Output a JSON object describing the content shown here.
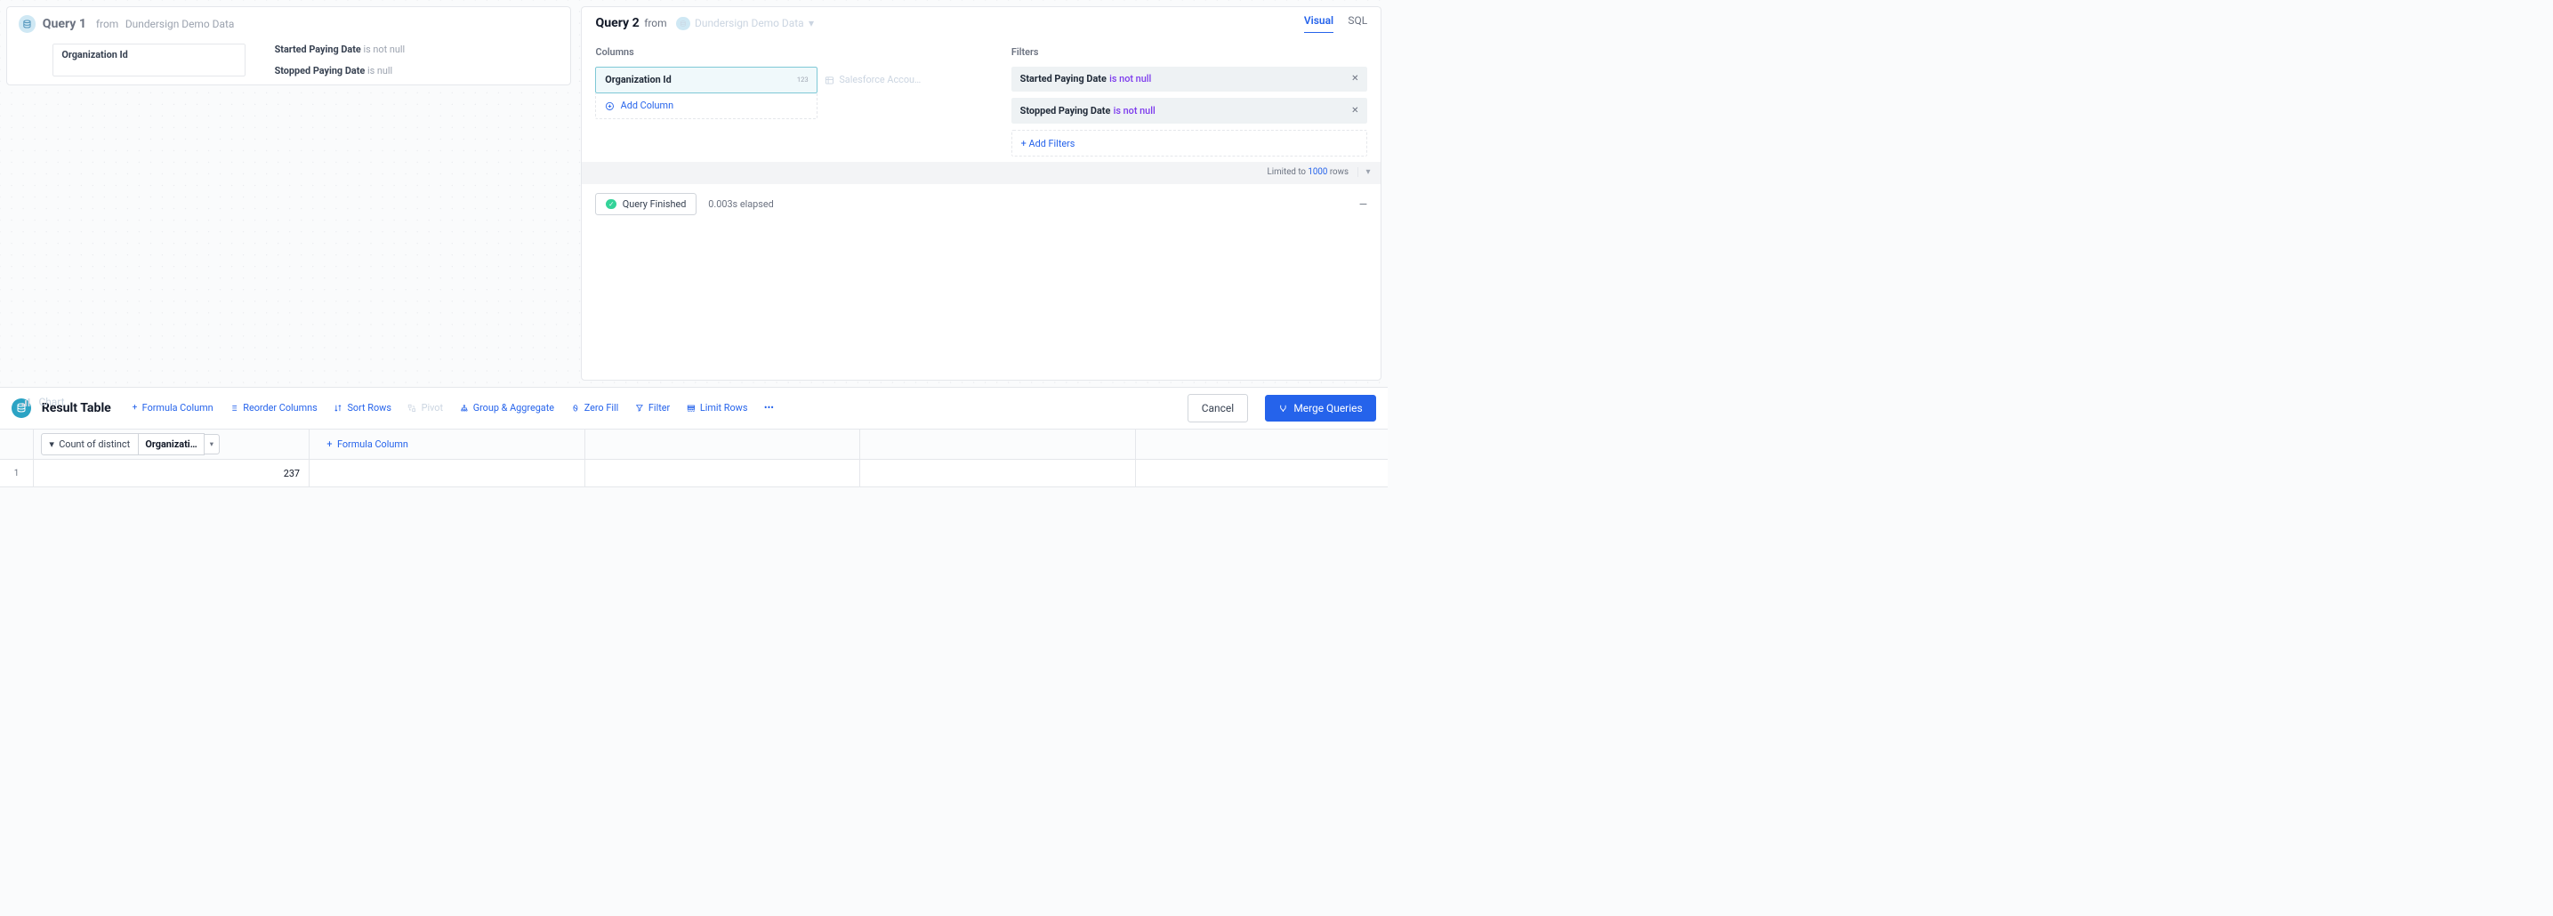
{
  "query1": {
    "title": "Query 1",
    "from_label": "from",
    "source": "Dundersign Demo Data",
    "column_chip": "Organization Id",
    "filters": [
      {
        "field": "Started Paying Date",
        "condition": "is not null"
      },
      {
        "field": "Stopped Paying Date",
        "condition": "is null"
      }
    ],
    "chart_label": "Chart"
  },
  "query2": {
    "title": "Query 2",
    "from_label": "from",
    "source": "Dundersign Demo Data",
    "tabs": {
      "visual": "Visual",
      "sql": "SQL",
      "active": "visual"
    },
    "columns_header": "Columns",
    "columns": [
      {
        "name": "Organization Id",
        "type_badge": "123"
      }
    ],
    "placeholder_next_col": "Salesforce Accou…",
    "add_column_label": "Add Column",
    "filters_header": "Filters",
    "filters": [
      {
        "field": "Started Paying Date",
        "condition": "is not null"
      },
      {
        "field": "Stopped Paying Date",
        "condition": "is not null"
      }
    ],
    "add_filters_label": "+ Add Filters",
    "limit": {
      "prefix": "Limited to",
      "n": "1000",
      "suffix": "rows"
    },
    "status": {
      "label": "Query Finished",
      "elapsed": "0.003s elapsed"
    }
  },
  "result": {
    "title": "Result Table",
    "actions": {
      "formula_column": "Formula Column",
      "reorder_columns": "Reorder Columns",
      "sort_rows": "Sort Rows",
      "pivot": "Pivot",
      "group_aggregate": "Group & Aggregate",
      "zero_fill": "Zero Fill",
      "filter": "Filter",
      "limit_rows": "Limit Rows"
    },
    "buttons": {
      "cancel": "Cancel",
      "merge": "Merge Queries"
    },
    "header": {
      "agg_selector": "Count of distinct",
      "col_name": "Organizati…",
      "add_formula": "Formula Column"
    },
    "rows": [
      {
        "n": "1",
        "value": "237"
      }
    ]
  }
}
